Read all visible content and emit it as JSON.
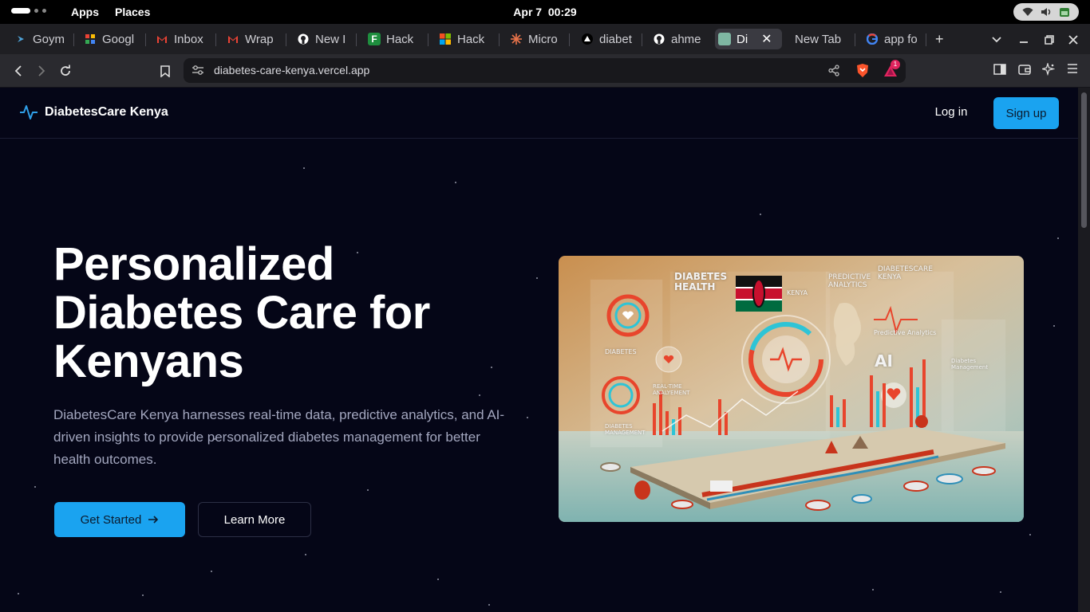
{
  "os_bar": {
    "apps_label": "Apps",
    "places_label": "Places",
    "date": "Apr 7",
    "time": "00:29"
  },
  "tabs": [
    {
      "label": "Goym",
      "icon": "goym-icon",
      "color": "#4fa3d9"
    },
    {
      "label": "Googl",
      "icon": "google-drive-icon",
      "color": "#f2b705"
    },
    {
      "label": "Inbox",
      "icon": "gmail-icon",
      "color": "#ea4335"
    },
    {
      "label": "Wrap",
      "icon": "gmail-icon",
      "color": "#ea4335"
    },
    {
      "label": "New I",
      "icon": "github-icon",
      "color": "#ffffff"
    },
    {
      "label": "Hack",
      "icon": "forms-icon",
      "color": "#1e8e3e"
    },
    {
      "label": "Hack",
      "icon": "microsoft-icon",
      "color": "#f25022"
    },
    {
      "label": "Micro",
      "icon": "sparkle-icon",
      "color": "#e8734a"
    },
    {
      "label": "diabet",
      "icon": "vercel-icon",
      "color": "#ffffff"
    },
    {
      "label": "ahme",
      "icon": "github-icon",
      "color": "#ffffff"
    },
    {
      "label": "Di",
      "icon": "site-icon",
      "color": "#7fb7a3"
    },
    {
      "label": "New Tab",
      "icon": "",
      "color": ""
    },
    {
      "label": "app fo",
      "icon": "google-icon",
      "color": "#4285f4"
    }
  ],
  "browser": {
    "url": "diabetes-care-kenya.vercel.app",
    "shields_badge": "1"
  },
  "site": {
    "brand": "DiabetesCare Kenya",
    "login": "Log in",
    "signup": "Sign up",
    "hero_line1": "Personalized",
    "hero_line2": "Diabetes Care for",
    "hero_line3": "Kenyans",
    "hero_sub": "DiabetesCare Kenya harnesses real-time data, predictive analytics, and AI-driven insights to provide personalized diabetes management for better health outcomes.",
    "cta_primary": "Get Started",
    "cta_secondary": "Learn More"
  },
  "hero_image": {
    "labels": {
      "diabetes_health": "DIABETES HEALTH",
      "predictive_analytics": "PREDICTIVE ANALYTICS",
      "care_kenya": "DIABETESCARE KENYA",
      "kenya": "KENYA",
      "predictive_small": "Predictive Analytics",
      "ai": "AI",
      "diabetes": "DIABETES",
      "realtime": "REAL-TIME ANALYEMENT",
      "management": "DIABETES MANAGEMENT",
      "management_right": "Diabetes Management"
    }
  },
  "colors": {
    "accent": "#1aa3f0",
    "page_bg": "#050617",
    "muted_text": "#a3a7bf"
  }
}
